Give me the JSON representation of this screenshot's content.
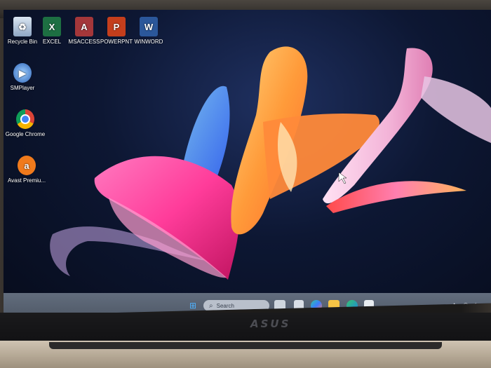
{
  "desktop": {
    "icons": [
      {
        "label": "Recycle Bin",
        "icon": "recycle-bin-icon"
      },
      {
        "label": "EXCEL",
        "icon": "excel-icon"
      },
      {
        "label": "MSACCESS",
        "icon": "access-icon"
      },
      {
        "label": "POWERPNT",
        "icon": "powerpoint-icon"
      },
      {
        "label": "WINWORD",
        "icon": "word-icon"
      },
      {
        "label": "SMPlayer",
        "icon": "smplayer-icon"
      },
      {
        "label": "Google Chrome",
        "icon": "chrome-icon"
      },
      {
        "label": "Avast Premiu...",
        "icon": "avast-icon"
      }
    ]
  },
  "taskbar": {
    "search_placeholder": "Search",
    "pinned": [
      "start-icon",
      "task-view-icon",
      "widgets-icon",
      "copilot-icon",
      "file-explorer-icon",
      "edge-icon",
      "store-icon"
    ],
    "tray": [
      "chevron-up-icon",
      "wifi-icon",
      "volume-icon",
      "battery-icon"
    ]
  },
  "device": {
    "brand": "ASUS"
  },
  "colors": {
    "excel": "#1d6f42",
    "access": "#a4373a",
    "powerpoint": "#c43e1c",
    "word": "#2b579a",
    "taskbar": "#5f6978"
  }
}
